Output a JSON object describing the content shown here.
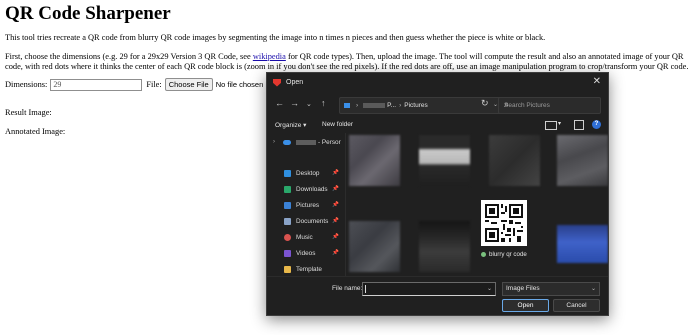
{
  "page": {
    "title": "QR Code Sharpener",
    "intro": "This tool tries recreate a QR code from blurry QR code images by segmenting the image into n times n pieces and then guess whether the piece is white or black.",
    "instructions_part1": "First, choose the dimensions (e.g. 29 for a 29x29 Version 3 QR Code, see ",
    "wiki_link": "wikipedia",
    "instructions_part2": " for QR code types). Then, upload the image. The tool will compute the result and also an annotated image of your QR code, with red dots where it thinks the center of each QR code block is (zoom in if you don't see the red pixels). If the red dots are off, use an image manipulation program to crop/transform your QR code.",
    "dimensions_label": "Dimensions:",
    "dimensions_value": "29",
    "file_label": "File:",
    "file_button": "Choose File",
    "file_status": "No file chosen",
    "result_label": "Result Image:",
    "annotated_label": "Annotated Image:"
  },
  "dialog": {
    "title": "Open",
    "close_glyph": "✕",
    "breadcrumb": {
      "segment1": "P...",
      "segment2": "Pictures"
    },
    "search_placeholder": "Search Pictures",
    "organize_label": "Organize ▾",
    "new_folder_label": "New folder",
    "help_glyph": "?",
    "nav_items": [
      {
        "label": "- Persor",
        "icon": "onedrive-icon"
      },
      {
        "label": "Desktop",
        "icon": "desktop-icon",
        "color": "#2f8fe0"
      },
      {
        "label": "Downloads",
        "icon": "downloads-icon",
        "color": "#2aa86b"
      },
      {
        "label": "Pictures",
        "icon": "pictures-icon",
        "color": "#3b82d6"
      },
      {
        "label": "Documents",
        "icon": "documents-icon",
        "color": "#8aa3c8"
      },
      {
        "label": "Music",
        "icon": "music-icon",
        "color": "#d9534f"
      },
      {
        "label": "Videos",
        "icon": "videos-icon",
        "color": "#7b54d1"
      },
      {
        "label": "Template",
        "icon": "folder-icon",
        "color": "#e8b84a"
      }
    ],
    "selected_file": "blurry qr code",
    "file_name_label": "File name:",
    "file_name_value": "",
    "file_type": "Image Files",
    "open_button": "Open",
    "cancel_button": "Cancel"
  }
}
